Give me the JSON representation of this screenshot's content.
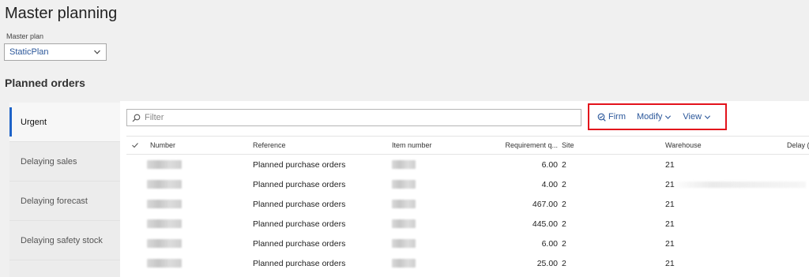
{
  "page": {
    "title": "Master planning",
    "master_plan_label": "Master plan",
    "master_plan_value": "StaticPlan",
    "section_title": "Planned orders"
  },
  "nav": {
    "items": [
      {
        "label": "Urgent",
        "active": true
      },
      {
        "label": "Delaying sales",
        "active": false
      },
      {
        "label": "Delaying forecast",
        "active": false
      },
      {
        "label": "Delaying safety stock",
        "active": false
      }
    ]
  },
  "toolbar": {
    "filter_placeholder": "Filter",
    "firm_label": "Firm",
    "modify_label": "Modify",
    "view_label": "View",
    "highlight_color": "#e3121b",
    "link_color": "#2b579a"
  },
  "grid": {
    "columns": [
      "Number",
      "Reference",
      "Item number",
      "Requirement q...",
      "Site",
      "Warehouse",
      "Delay ("
    ],
    "rows": [
      {
        "reference": "Planned purchase orders",
        "quantity": "6.00",
        "site": "2",
        "warehouse": "21"
      },
      {
        "reference": "Planned purchase orders",
        "quantity": "4.00",
        "site": "2",
        "warehouse": "21"
      },
      {
        "reference": "Planned purchase orders",
        "quantity": "467.00",
        "site": "2",
        "warehouse": "21"
      },
      {
        "reference": "Planned purchase orders",
        "quantity": "445.00",
        "site": "2",
        "warehouse": "21"
      },
      {
        "reference": "Planned purchase orders",
        "quantity": "6.00",
        "site": "2",
        "warehouse": "21"
      },
      {
        "reference": "Planned purchase orders",
        "quantity": "25.00",
        "site": "2",
        "warehouse": "21"
      }
    ]
  }
}
